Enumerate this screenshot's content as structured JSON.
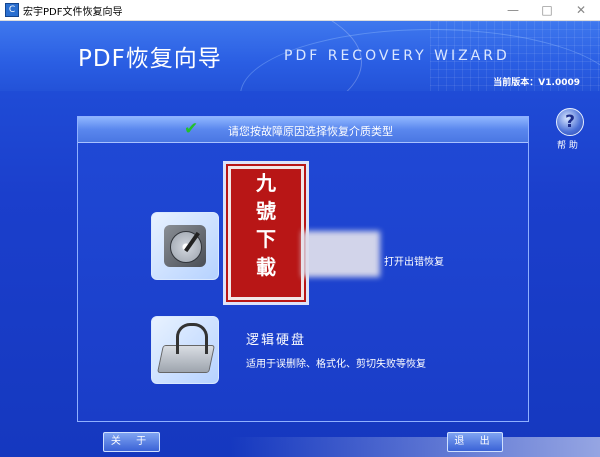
{
  "window": {
    "title": "宏宇PDF文件恢复向导",
    "icon_name": "app-icon",
    "minimize_glyph": "—",
    "maximize_glyph": "□",
    "close_glyph": "✕"
  },
  "header": {
    "title": "PDF恢复向导",
    "subtitle": "PDF RECOVERY WIZARD",
    "version": "当前版本：V1.0009"
  },
  "help": {
    "icon": "?",
    "label": "帮 助"
  },
  "panel": {
    "prompt": "请您按故障原因选择恢复介质类型",
    "options": [
      {
        "icon": "hard-disk-icon",
        "title": "",
        "description": "打开出错恢复"
      },
      {
        "icon": "disk-stethoscope-icon",
        "title": "逻辑硬盘",
        "description": "适用于误删除、格式化、剪切失败等恢复"
      }
    ]
  },
  "watermark": {
    "chars": [
      "九",
      "號",
      "下",
      "載"
    ]
  },
  "buttons": {
    "about": "关 于",
    "exit": "退 出"
  },
  "colors": {
    "background": "#1b3fcc",
    "header": "#2a5ee3",
    "panel_head": "#5a87ee",
    "stamp": "#b81616",
    "check": "#22c02b"
  }
}
